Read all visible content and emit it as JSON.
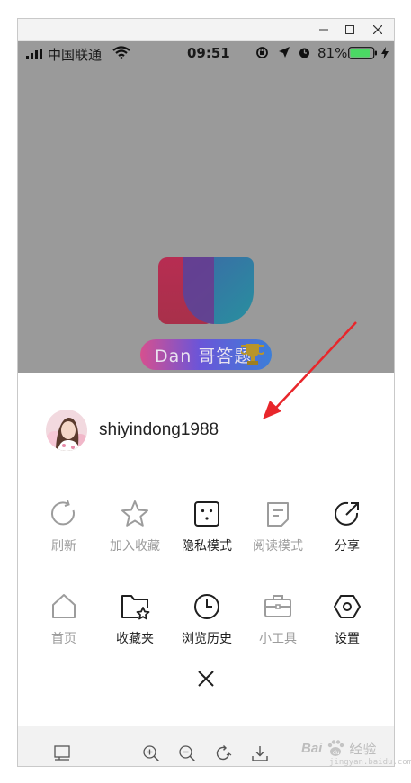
{
  "status_bar": {
    "carrier": "中国联通",
    "time": "09:51",
    "battery": "81%"
  },
  "background_app": {
    "brand_text": "Dan 哥答题"
  },
  "sheet": {
    "username": "shiyindong1988",
    "row1": [
      {
        "label": "刷新",
        "icon": "refresh-icon",
        "active": false
      },
      {
        "label": "加入收藏",
        "icon": "star-icon",
        "active": false
      },
      {
        "label": "隐私模式",
        "icon": "privacy-face-icon",
        "active": true
      },
      {
        "label": "阅读模式",
        "icon": "reader-icon",
        "active": false
      },
      {
        "label": "分享",
        "icon": "share-icon",
        "active": true
      }
    ],
    "row2": [
      {
        "label": "首页",
        "icon": "home-icon",
        "active": false
      },
      {
        "label": "收藏夹",
        "icon": "bookmark-folder-icon",
        "active": true
      },
      {
        "label": "浏览历史",
        "icon": "history-clock-icon",
        "active": true
      },
      {
        "label": "小工具",
        "icon": "toolbox-icon",
        "active": false
      },
      {
        "label": "设置",
        "icon": "settings-hexagon-icon",
        "active": true
      }
    ]
  },
  "toolbar_icons": [
    "layout-icon",
    "zoom-in-icon",
    "zoom-out-icon",
    "rotate-icon",
    "download-icon"
  ],
  "watermark": {
    "brand": "Bai",
    "paw": "du",
    "jingyan": "经验",
    "url": "jingyan.baidu.com"
  },
  "colors": {
    "active": "#1f1f1f",
    "inactive": "#9c9c9c",
    "arrow": "#e8262b",
    "overlay": "#9a9a9a"
  }
}
